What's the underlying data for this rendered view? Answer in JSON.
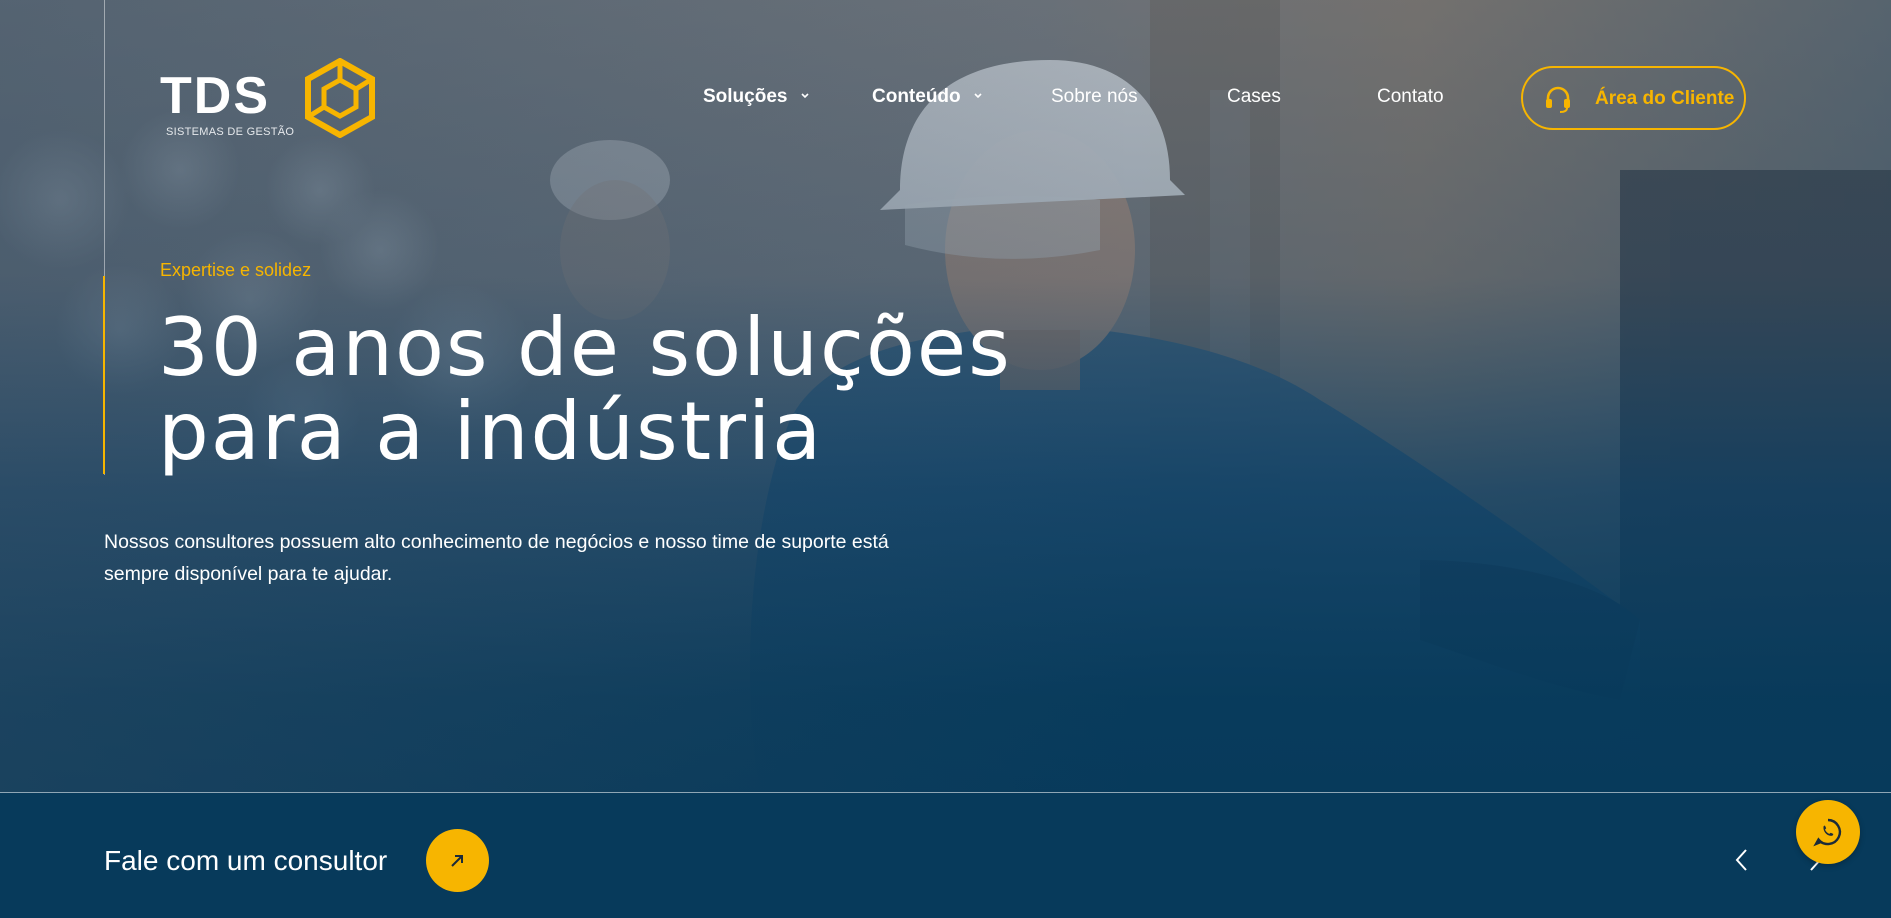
{
  "logo": {
    "name": "TDS",
    "tagline": "SISTEMAS DE GESTÃO"
  },
  "nav": {
    "items": [
      {
        "label": "Soluções",
        "has_dropdown": true
      },
      {
        "label": "Conteúdo",
        "has_dropdown": true
      },
      {
        "label": "Sobre nós",
        "has_dropdown": false
      },
      {
        "label": "Cases",
        "has_dropdown": false
      },
      {
        "label": "Contato",
        "has_dropdown": false
      }
    ],
    "client_area": {
      "label": "Área do Cliente",
      "icon": "headset-icon"
    }
  },
  "hero": {
    "eyebrow": "Expertise e solidez",
    "headline_line1": "30 anos de soluções",
    "headline_line2": "para a indústria",
    "description_line1": "Nossos consultores possuem alto conhecimento de negócios e nosso time de suporte está",
    "description_line2": "sempre disponível para te ajudar."
  },
  "cta": {
    "label": "Fale com um consultor",
    "icon": "arrow-up-right-icon"
  },
  "carousel": {
    "prev_icon": "chevron-left-icon",
    "next_icon": "chevron-right-icon"
  },
  "whatsapp": {
    "icon": "whatsapp-icon"
  },
  "colors": {
    "accent": "#f7b500",
    "navy": "#073a5b",
    "text": "#ffffff"
  }
}
